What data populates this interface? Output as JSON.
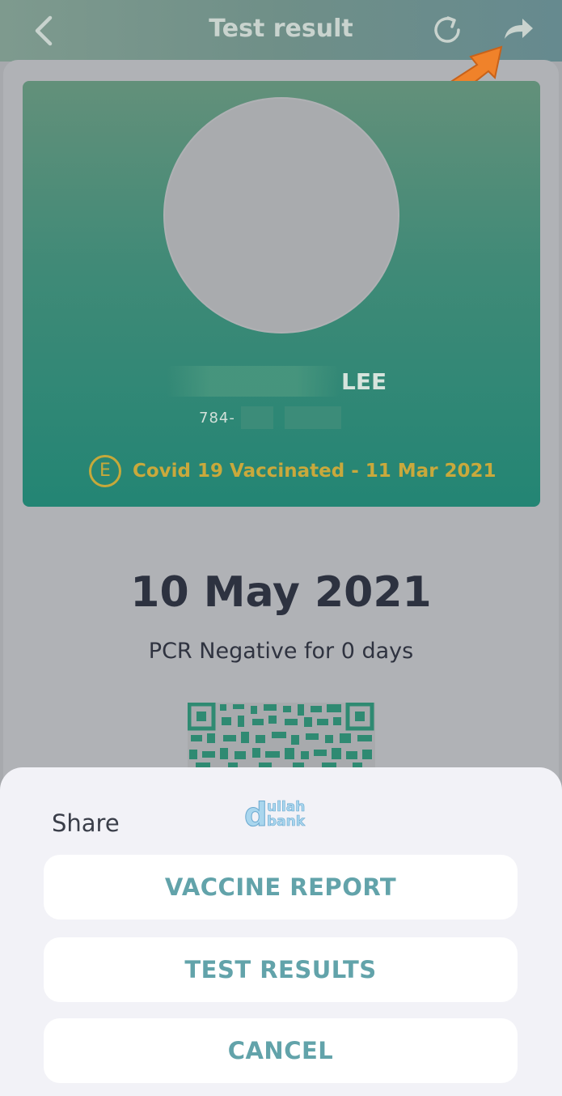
{
  "header": {
    "title": "Test result",
    "back_icon": "chevron-left-icon",
    "refresh_icon": "refresh-icon",
    "share_icon": "share-forward-icon"
  },
  "card": {
    "name_visible": "LEE",
    "id_number_partial": "784-",
    "vaccine_badge": "E",
    "vaccine_status": "Covid 19 Vaccinated - 11 Mar 2021",
    "colors": {
      "gradient_top": "#63907a",
      "gradient_bottom": "#238574",
      "badge": "#c6a93a"
    }
  },
  "result": {
    "date": "10 May 2021",
    "summary": "PCR Negative for 0 days"
  },
  "share_sheet": {
    "title": "Share",
    "watermark_text": "dullah bank",
    "buttons": {
      "vaccine_report": "VACCINE REPORT",
      "test_results": "TEST RESULTS",
      "cancel": "CANCEL"
    },
    "accent_color": "#62a3aa"
  },
  "annotation": {
    "callout_color": "#f0822a"
  }
}
